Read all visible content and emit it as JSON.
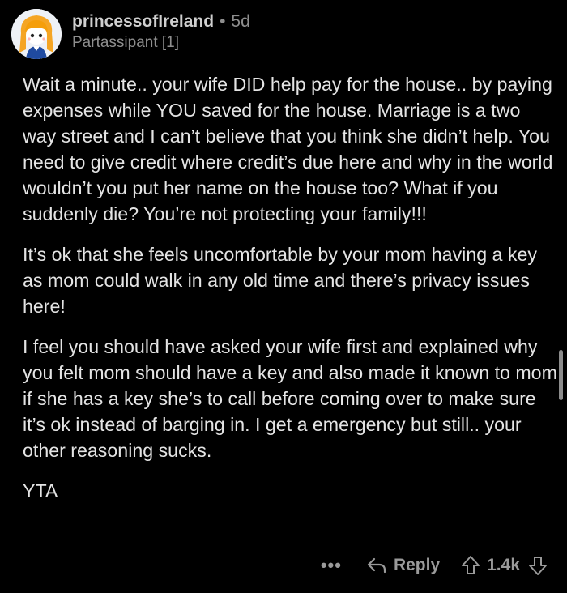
{
  "comment": {
    "author": "princessofIreland",
    "separator": "•",
    "age": "5d",
    "flair": "Partassipant [1]",
    "paragraphs": [
      "Wait a minute.. your wife DID help pay for the house.. by paying expenses while YOU saved for the house. Marriage is a two way street and I can’t believe that you think she didn’t help. You need to give credit where credit’s due here and why in the world wouldn’t you put her name on the house too? What if you suddenly die? You’re not protecting your family!!!",
      "It’s ok that she feels uncomfortable by your mom having a key as mom could walk in any old time and there’s privacy issues here!",
      "I feel you should have asked your wife first and explained why you felt mom should have a key and also made it known to mom if she has a key she’s to call before coming over to make sure it’s ok instead of barging in. I get a emergency but still.. your other reasoning sucks.",
      "YTA"
    ]
  },
  "actions": {
    "more": "•••",
    "reply_label": "Reply",
    "score": "1.4k"
  },
  "icons": {
    "more": "more-options-icon",
    "reply": "reply-arrow-icon",
    "upvote": "upvote-arrow-icon",
    "downvote": "downvote-arrow-icon"
  },
  "colors": {
    "background": "#000000",
    "body_text": "#e4e4e4",
    "muted": "#8e8e8e",
    "avatar_hair": "#f5a524"
  }
}
